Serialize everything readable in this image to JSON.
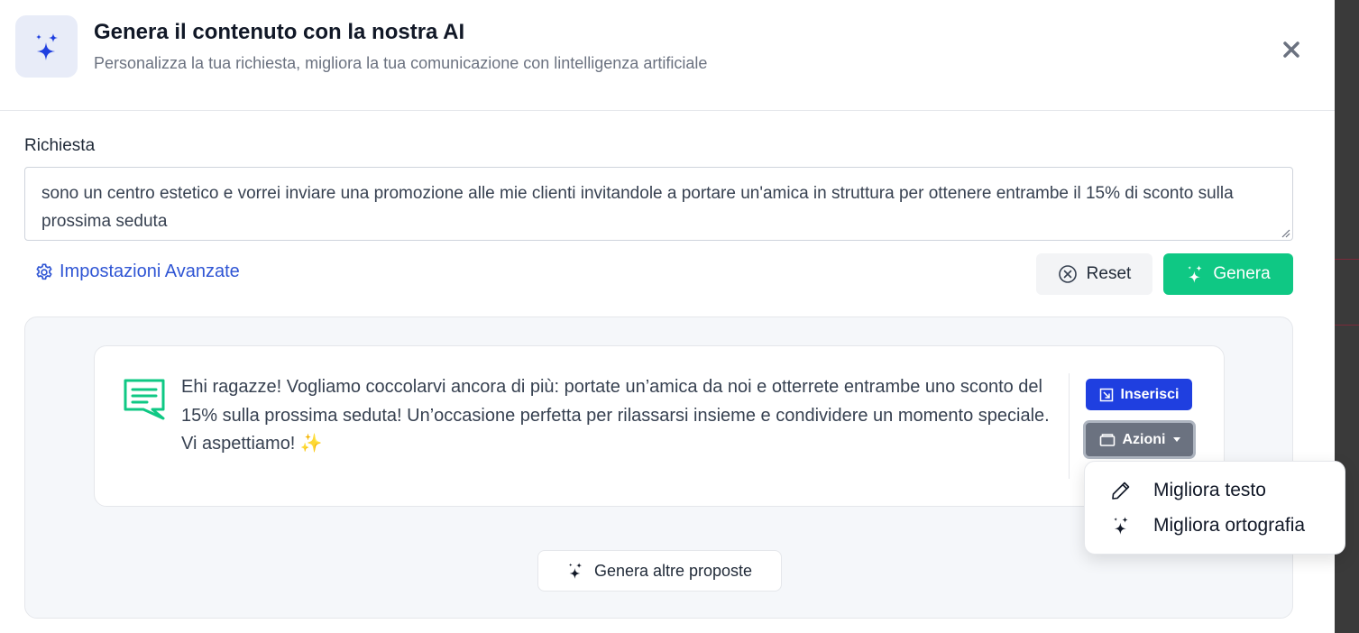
{
  "header": {
    "title": "Genera il contenuto con la nostra AI",
    "subtitle": "Personalizza la tua richiesta, migliora la tua comunicazione con lintelligenza artificiale",
    "icon": "sparkles-icon",
    "close_icon": "close-icon"
  },
  "request": {
    "label": "Richiesta",
    "value": "sono un centro estetico e vorrei inviare una promozione alle mie clienti invitandole a portare un'amica in struttura per ottenere entrambe il 15% di sconto sulla prossima seduta"
  },
  "advanced_link": "Impostazioni Avanzate",
  "buttons": {
    "reset": "Reset",
    "generate": "Genera",
    "generate_more": "Genera altre proposte"
  },
  "result": {
    "text": "Ehi ragazze! Vogliamo coccolarvi ancora di più: portate un’amica da noi e otterrete entrambe uno sconto del 15% sulla prossima seduta! Un’occasione perfetta per rilassarsi insieme e condividere un momento speciale. Vi aspettiamo! ✨",
    "insert_label": "Inserisci",
    "actions_label": "Azioni"
  },
  "dropdown": {
    "items": [
      {
        "label": "Migliora testo",
        "icon": "pencil-icon"
      },
      {
        "label": "Migliora ortografia",
        "icon": "sparkles-icon"
      }
    ]
  },
  "colors": {
    "primary_green": "#0fc884",
    "primary_blue": "#1f3fe0",
    "link_blue": "#2f55d4",
    "actions_gray": "#6b7280"
  }
}
